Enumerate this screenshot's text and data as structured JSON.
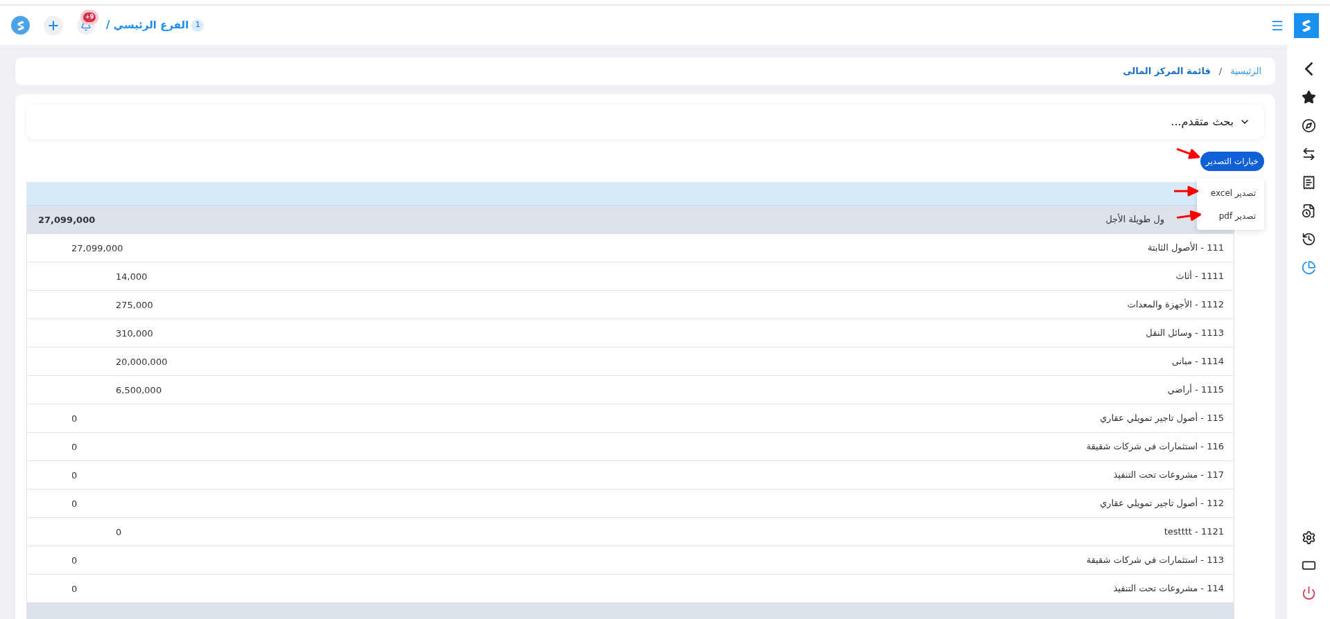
{
  "top_bar": {
    "branch_count": "1",
    "branch_name": "الفرع الرئيسي /",
    "notification_badge": "+9"
  },
  "breadcrumb": {
    "separator": "/",
    "items": [
      {
        "label": "الرئيسية",
        "current": false
      },
      {
        "label": "قائمة المركز المالى",
        "current": true
      }
    ]
  },
  "advanced_search": {
    "label": "بحث متقدم...",
    "expanded": false
  },
  "export": {
    "button": "خيارات التصدير",
    "menu": [
      "تصدير excel",
      "تصدير pdf"
    ]
  },
  "sidebar": {
    "items": [
      {
        "selected": false
      },
      {
        "selected": false
      },
      {
        "selected": false
      },
      {
        "selected": false
      },
      {
        "selected": false
      },
      {
        "selected": false
      },
      {
        "selected": false
      },
      {
        "selected": true
      }
    ]
  },
  "table": {
    "rows": [
      {
        "label": "ول طويلة الأجل",
        "amount": "27,099,000",
        "children": [
          {
            "label": "111 - الأصول الثابتة",
            "amount": "27,099,000",
            "children": [
              {
                "label": "1111 - أثاث",
                "amount": "14,000"
              },
              {
                "label": "1112 - الأجهزة والمعدات",
                "amount": "275,000"
              },
              {
                "label": "1113 - وسائل النقل",
                "amount": "310,000"
              },
              {
                "label": "1114 - مبانى",
                "amount": "20,000,000"
              },
              {
                "label": "1115 - أراضي",
                "amount": "6,500,000"
              }
            ]
          },
          {
            "label": "115 - أصول تاجير تمويلي عقاري",
            "amount": "0"
          },
          {
            "label": "116 - استثمارات في شركات شقيقة",
            "amount": "0"
          },
          {
            "label": "117 - مشروعات تحت التنفيذ",
            "amount": "0"
          },
          {
            "label": "112 - أصول تاجير تمويلي عقاري",
            "amount": "0",
            "children": [
              {
                "label": "testttt - 1121",
                "amount": "0"
              }
            ]
          },
          {
            "label": "113 - استثمارات في شركات شقيقة",
            "amount": "0"
          },
          {
            "label": "114 - مشروعات تحت التنفيذ",
            "amount": "0"
          }
        ]
      }
    ]
  }
}
